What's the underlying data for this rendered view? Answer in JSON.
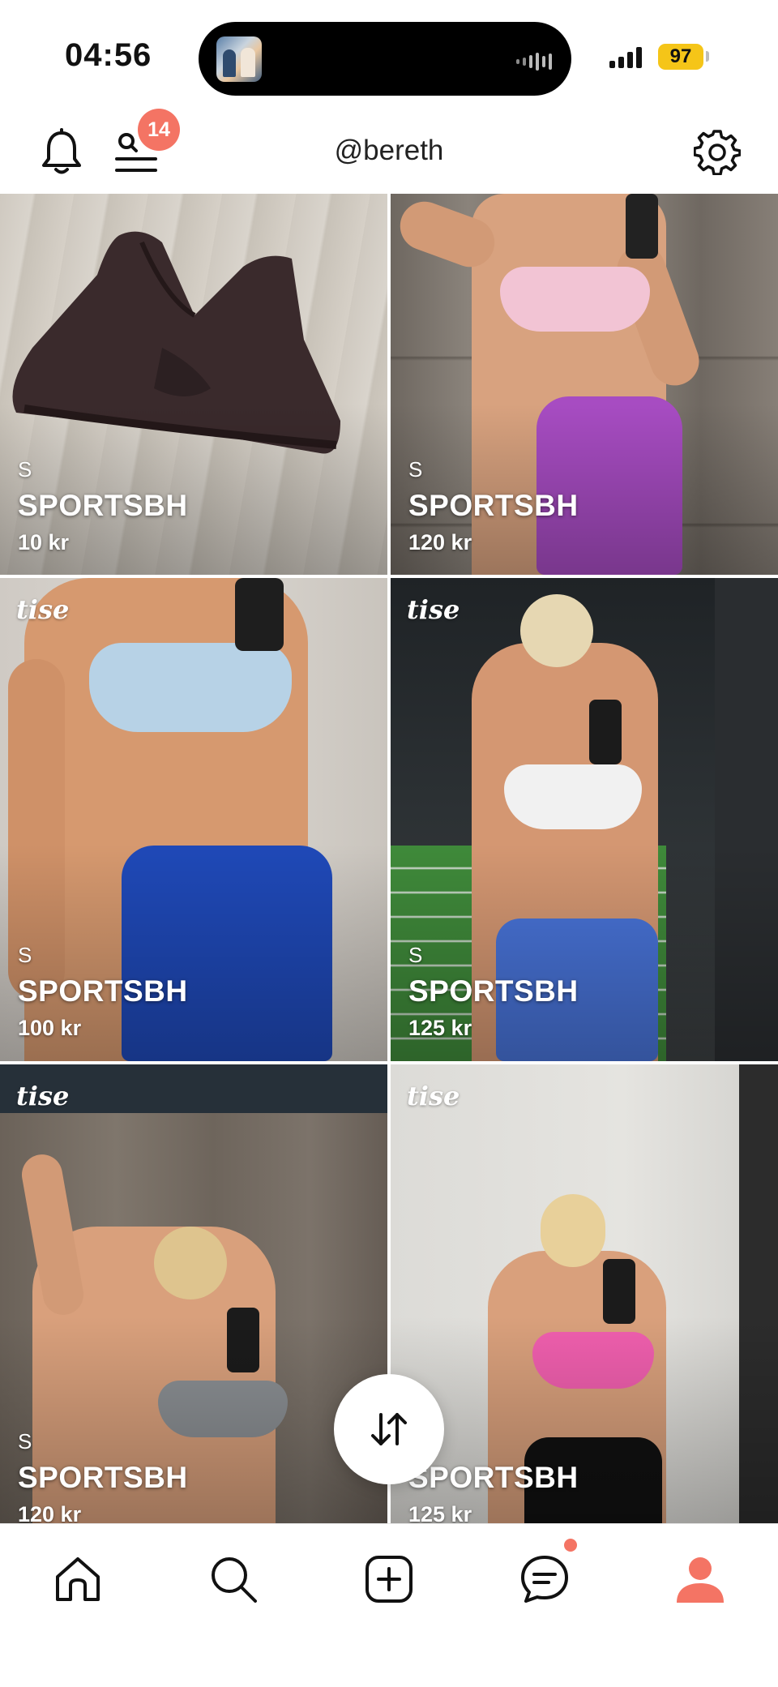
{
  "status_bar": {
    "time": "04:56",
    "battery": "97"
  },
  "header": {
    "username": "@bereth",
    "search_badge_count": "14"
  },
  "listings": [
    {
      "brand": "",
      "size": "S",
      "title": "SPORTSBH",
      "price": "10 kr"
    },
    {
      "brand": "",
      "size": "S",
      "title": "SPORTSBH",
      "price": "120 kr"
    },
    {
      "brand": "tise",
      "size": "S",
      "title": "SPORTSBH",
      "price": "100 kr"
    },
    {
      "brand": "tise",
      "size": "S",
      "title": "SPORTSBH",
      "price": "125 kr"
    },
    {
      "brand": "tise",
      "size": "S",
      "title": "SPORTSBH",
      "price": "120 kr"
    },
    {
      "brand": "tise",
      "size": "",
      "title": "SPORTSBH",
      "price": "125 kr"
    }
  ],
  "colors": {
    "accent": "#f47464",
    "battery": "#f5c518"
  }
}
